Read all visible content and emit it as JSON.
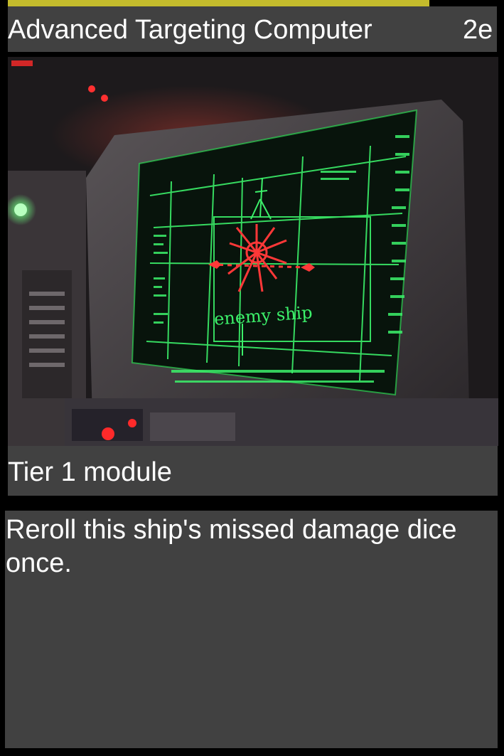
{
  "card": {
    "title": "Advanced Targeting Computer",
    "cost": "2e",
    "tier": "Tier 1 module",
    "rules_text": "Reroll this ship's missed damage dice once.",
    "art": {
      "screen_label": "enemy ship",
      "icon_name": "targeting-computer-screen-art"
    }
  },
  "colors": {
    "accent": "#c4bb2c",
    "panel": "#414141",
    "background": "#000000",
    "text": "#ffffff",
    "screen_green": "#3cf06a",
    "target_red": "#ff3838"
  }
}
